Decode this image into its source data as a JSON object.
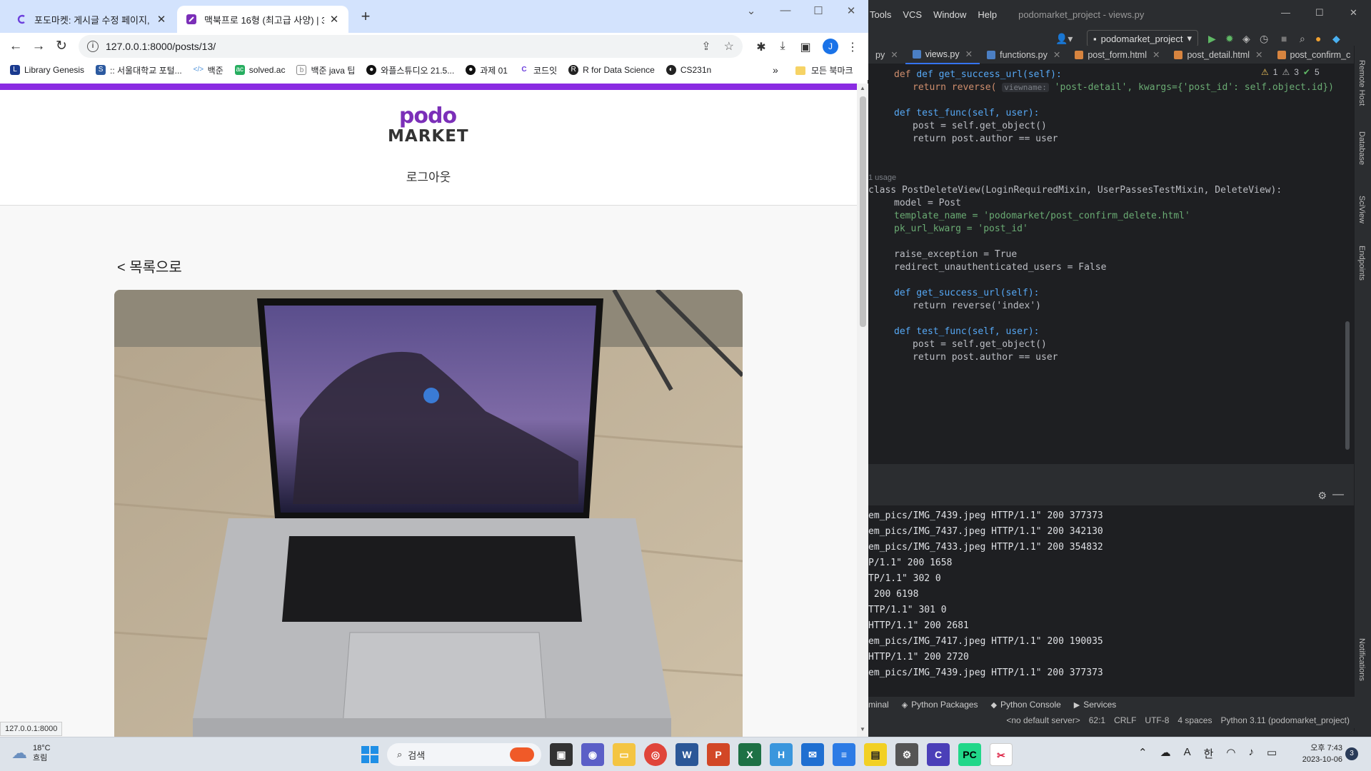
{
  "browser": {
    "tabs": [
      {
        "title": "포도마켓: 게시글 수정 페이지, ( ",
        "active": false
      },
      {
        "title": "맥북프로 16형 (최고급 사양) | 3",
        "active": true
      }
    ],
    "url": "127.0.0.1:8000/posts/13/",
    "profile_initial": "J",
    "bookmarks": [
      {
        "label": "Library Genesis",
        "icon": "libgen-icon",
        "color": "#1a3a8f"
      },
      {
        "label": ":: 서울대학교 포털...",
        "icon": "snu-icon",
        "color": "#2c5aa0"
      },
      {
        "label": "백준",
        "icon": "code-icon",
        "color": "#4a90d9"
      },
      {
        "label": "solved.ac",
        "icon": "solvedac-icon",
        "color": "#27ae60"
      },
      {
        "label": "백준 java 팁",
        "icon": "blog-icon",
        "color": "#888888"
      },
      {
        "label": "와플스튜디오 21.5...",
        "icon": "github-icon",
        "color": "#111111"
      },
      {
        "label": "과제 01",
        "icon": "github-icon",
        "color": "#111111"
      },
      {
        "label": "코드잇",
        "icon": "codeit-icon",
        "color": "#6c3fdc"
      },
      {
        "label": "R for Data Science",
        "icon": "globe-icon",
        "color": "#222222"
      },
      {
        "label": "CS231n",
        "icon": "globe-icon",
        "color": "#222222"
      }
    ],
    "bookmarks_all": "모든 북마크",
    "status_url": "127.0.0.1:8000"
  },
  "page": {
    "logo_top": "podo",
    "logo_bottom": "MARKET",
    "logout": "로그아웃",
    "back_link": "< 목록으로"
  },
  "ide": {
    "menu": [
      "Tools",
      "VCS",
      "Window",
      "Help"
    ],
    "window_title": "podomarket_project - views.py",
    "project": "podomarket_project",
    "tabs": [
      {
        "label": "py",
        "active": false
      },
      {
        "label": "views.py",
        "active": true
      },
      {
        "label": "functions.py",
        "active": false
      },
      {
        "label": "post_form.html",
        "active": false
      },
      {
        "label": "post_detail.html",
        "active": false
      },
      {
        "label": "post_confirm_c",
        "active": false
      }
    ],
    "inspections": {
      "warnings": "1",
      "weak": "3",
      "ok": "5"
    },
    "code": {
      "l1": "def get_success_url(self):",
      "l2a": "return reverse(",
      "l2hint": "viewname:",
      "l2b": "'post-detail', kwargs={'post_id': self.object.id})",
      "l3": "def test_func(self, user):",
      "l4": "post = self.get_object()",
      "l5": "return post.author == user",
      "usage": "1 usage",
      "l6": "class PostDeleteView(LoginRequiredMixin, UserPassesTestMixin, DeleteView):",
      "l7": "model = Post",
      "l8": "template_name = 'podomarket/post_confirm_delete.html'",
      "l9": "pk_url_kwarg = 'post_id'",
      "l10": "raise_exception = True",
      "l11": "redirect_unauthenticated_users = False",
      "l12": "def get_success_url(self):",
      "l13": "return reverse('index')",
      "l14": "def test_func(self, user):",
      "l15": "post = self.get_object()",
      "l16": "return post.author == user"
    },
    "terminal_lines": [
      "em_pics/IMG_7439.jpeg HTTP/1.1\" 200 377373",
      "em_pics/IMG_7437.jpeg HTTP/1.1\" 200 342130",
      "em_pics/IMG_7433.jpeg HTTP/1.1\" 200 354832",
      "P/1.1\" 200 1658",
      "TP/1.1\" 302 0",
      " 200 6198",
      "TTP/1.1\" 301 0",
      "HTTP/1.1\" 200 2681",
      "em_pics/IMG_7417.jpeg HTTP/1.1\" 200 190035",
      "HTTP/1.1\" 200 2720",
      "em_pics/IMG_7439.jpeg HTTP/1.1\" 200 377373"
    ],
    "bottom_tabs": [
      "minal",
      "Python Packages",
      "Python Console",
      "Services"
    ],
    "status": [
      "<no default server>",
      "62:1",
      "CRLF",
      "UTF-8",
      "4 spaces",
      "Python 3.11 (podomarket_project)"
    ],
    "right_bar": [
      "Remote Host",
      "Database",
      "SciView",
      "Endpoints",
      "Notifications"
    ]
  },
  "taskbar": {
    "temperature": "18°C",
    "weather": "흐림",
    "search_placeholder": "검색",
    "ime": "한",
    "time": "오후 7:43",
    "date": "2023-10-06",
    "notifications": "3"
  }
}
